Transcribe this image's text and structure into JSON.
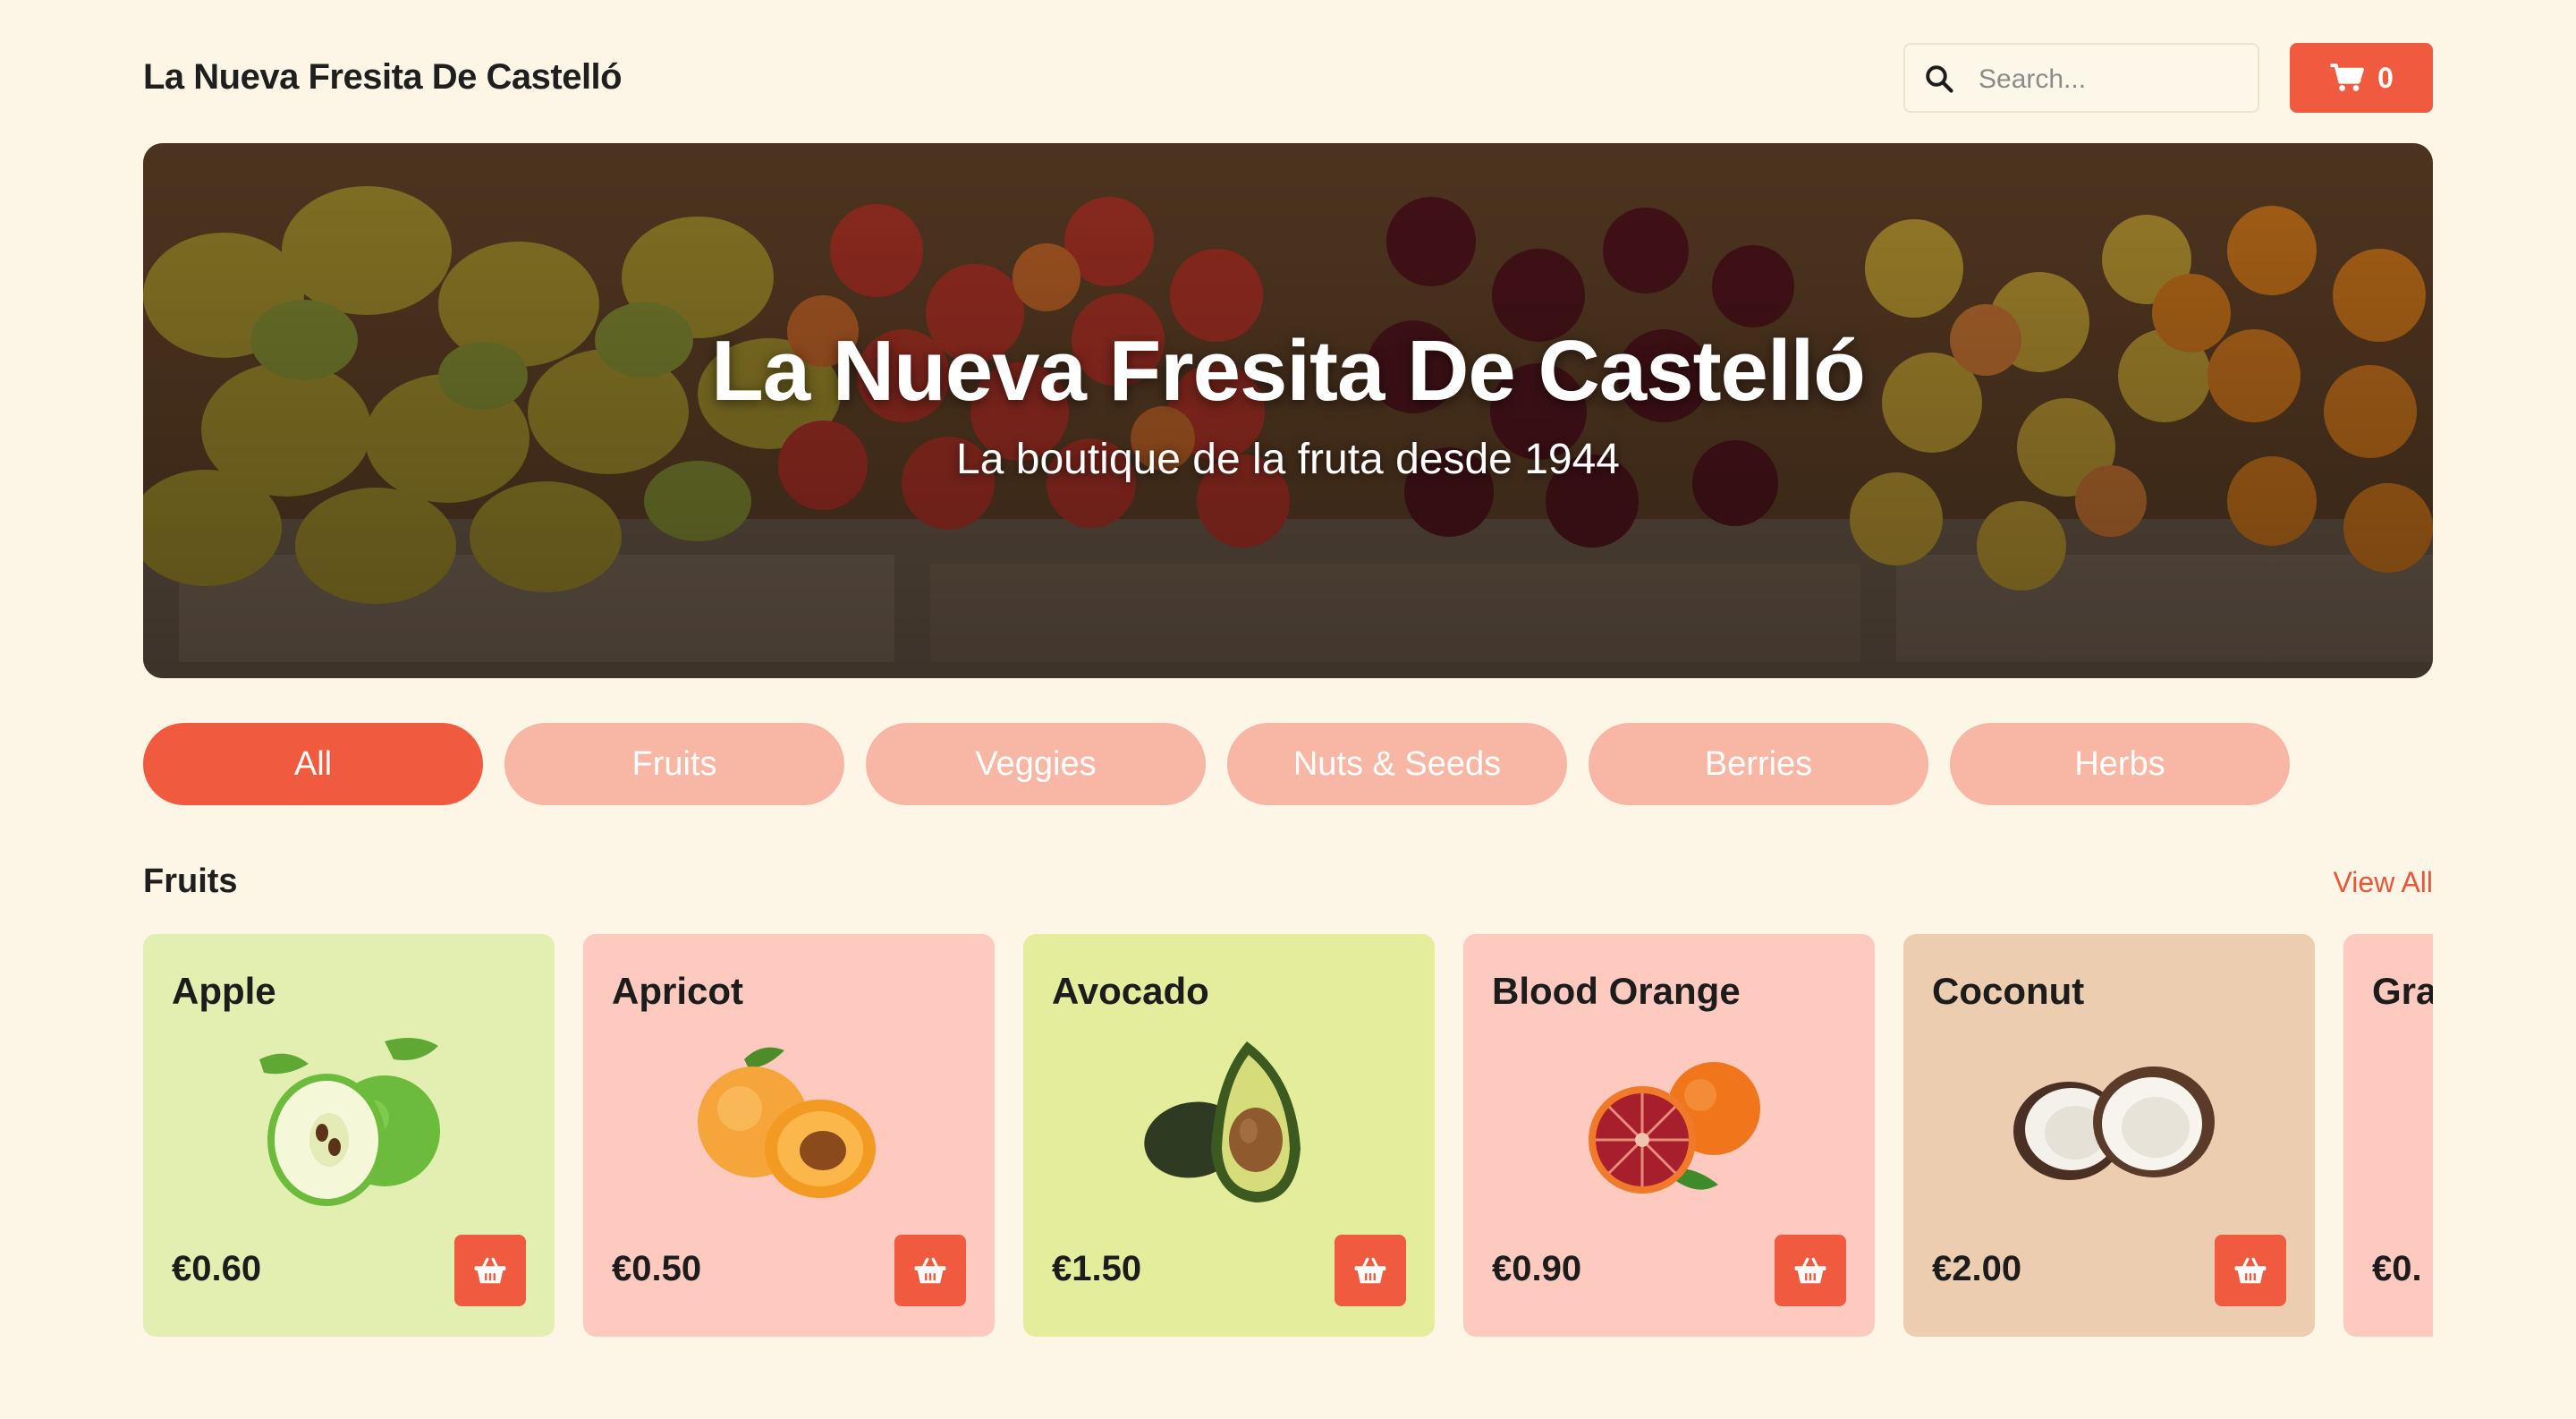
{
  "header": {
    "brand": "La Nueva Fresita De Castelló",
    "search_placeholder": "Search...",
    "cart_count": "0"
  },
  "hero": {
    "title": "La Nueva Fresita De Castelló",
    "subtitle": "La boutique de la fruta desde 1944"
  },
  "categories": [
    "All",
    "Fruits",
    "Veggies",
    "Nuts & Seeds",
    "Berries",
    "Herbs"
  ],
  "active_category": "All",
  "section": {
    "title": "Fruits",
    "view_all": "View All"
  },
  "products": [
    {
      "name": "Apple",
      "price": "€0.60",
      "bg": "#e3efb1"
    },
    {
      "name": "Apricot",
      "price": "€0.50",
      "bg": "#fecac0"
    },
    {
      "name": "Avocado",
      "price": "€1.50",
      "bg": "#e3ed9c"
    },
    {
      "name": "Blood Orange",
      "price": "€0.90",
      "bg": "#fecac0"
    },
    {
      "name": "Coconut",
      "price": "€2.00",
      "bg": "#eccdb0"
    },
    {
      "name": "Gra",
      "price": "€0.",
      "bg": "#fecac0"
    }
  ],
  "colors": {
    "accent": "#f05b40",
    "chip_inactive": "#f8b7a4",
    "background": "#fdf6e6"
  }
}
